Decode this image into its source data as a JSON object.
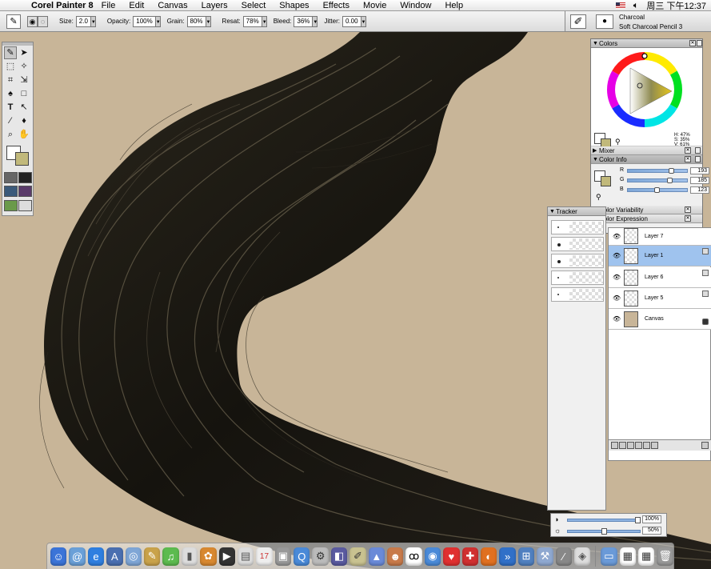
{
  "menubar": {
    "app_name": "Corel Painter 8",
    "menus": [
      "File",
      "Edit",
      "Canvas",
      "Layers",
      "Select",
      "Shapes",
      "Effects",
      "Movie",
      "Window",
      "Help"
    ],
    "clock": "周三 下午12:37"
  },
  "property_bar": {
    "size_label": "Size:",
    "size_value": "2.0",
    "opacity_label": "Opacity:",
    "opacity_value": "100%",
    "grain_label": "Grain:",
    "grain_value": "80%",
    "resat_label": "Resat:",
    "resat_value": "78%",
    "bleed_label": "Bleed:",
    "bleed_value": "36%",
    "jitter_label": "Jitter:",
    "jitter_value": "0.00"
  },
  "brush_selector": {
    "category": "Charcoal",
    "variant": "Soft Charcoal Pencil 3"
  },
  "colors_panel": {
    "title": "Colors",
    "hsv": {
      "h": "H: 47%",
      "s": "S: 35%",
      "v": "V: 61%"
    },
    "mixer_label": "Mixer",
    "color_info_label": "Color Info",
    "rgb": [
      {
        "label": "R",
        "value": "193",
        "fraction": 0.757
      },
      {
        "label": "G",
        "value": "185",
        "fraction": 0.725
      },
      {
        "label": "B",
        "value": "123",
        "fraction": 0.482
      }
    ],
    "variability_label": "Color Variability",
    "expression_label": "Color Expression",
    "main_color": "#c1b97b"
  },
  "tracker": {
    "title": "Tracker"
  },
  "layers": {
    "items": [
      {
        "name": "Layer 7"
      },
      {
        "name": "Layer 1",
        "selected": true
      },
      {
        "name": "Layer 6"
      },
      {
        "name": "Layer 5"
      },
      {
        "name": "Canvas"
      }
    ]
  },
  "opacity_sliders": [
    {
      "icon": "opacity-icon",
      "value": "100%",
      "fraction": 1.0
    },
    {
      "icon": "brightness-icon",
      "value": "50%",
      "fraction": 0.5
    }
  ],
  "canvas": {
    "paper_color": "#c8b598",
    "hair_color": "#1d1a13"
  }
}
